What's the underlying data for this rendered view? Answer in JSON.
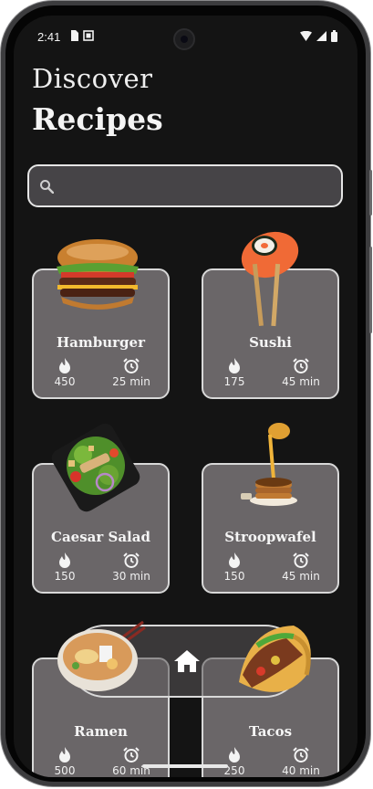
{
  "status_bar": {
    "time": "2:41"
  },
  "header": {
    "line1": "Discover",
    "line2": "Recipes"
  },
  "search": {
    "placeholder": ""
  },
  "recipes": [
    {
      "name": "Hamburger",
      "calories": "450",
      "time": "25 min"
    },
    {
      "name": "Sushi",
      "calories": "175",
      "time": "45 min"
    },
    {
      "name": "Caesar Salad",
      "calories": "150",
      "time": "30 min"
    },
    {
      "name": "Stroopwafel",
      "calories": "150",
      "time": "45 min"
    },
    {
      "name": "Ramen",
      "calories": "500",
      "time": "60 min"
    },
    {
      "name": "Tacos",
      "calories": "250",
      "time": "40 min"
    }
  ],
  "icons": {
    "calories": "flame-icon",
    "time": "alarm-clock-icon",
    "nav": "home-icon",
    "search": "search-icon"
  },
  "colors": {
    "background": "#141414",
    "card": "#6a6668",
    "text": "#f5f5f5"
  }
}
